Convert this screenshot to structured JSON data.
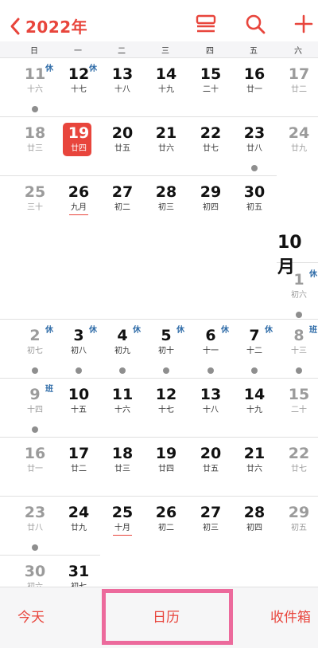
{
  "nav": {
    "back_label": "2022年",
    "icons": [
      "list-view-icon",
      "search-icon",
      "add-icon"
    ]
  },
  "weekdays": [
    "日",
    "一",
    "二",
    "三",
    "四",
    "五",
    "六"
  ],
  "month_label": "10月",
  "days": [
    {
      "n": "11",
      "l": "十六",
      "badge": "休",
      "dot": true,
      "muted": true
    },
    {
      "n": "12",
      "l": "十七",
      "badge": "休"
    },
    {
      "n": "13",
      "l": "十八"
    },
    {
      "n": "14",
      "l": "十九"
    },
    {
      "n": "15",
      "l": "二十"
    },
    {
      "n": "16",
      "l": "廿一"
    },
    {
      "n": "17",
      "l": "廿二",
      "muted": true
    },
    {
      "n": "18",
      "l": "廿三",
      "muted": true
    },
    {
      "n": "19",
      "l": "廿四",
      "today": true
    },
    {
      "n": "20",
      "l": "廿五"
    },
    {
      "n": "21",
      "l": "廿六"
    },
    {
      "n": "22",
      "l": "廿七"
    },
    {
      "n": "23",
      "l": "廿八",
      "dot": true
    },
    {
      "n": "24",
      "l": "廿九",
      "muted": true
    },
    {
      "n": "25",
      "l": "三十",
      "muted": true
    },
    {
      "n": "26",
      "l": "九月",
      "underline": true
    },
    {
      "n": "27",
      "l": "初二"
    },
    {
      "n": "28",
      "l": "初三"
    },
    {
      "n": "29",
      "l": "初四"
    },
    {
      "n": "30",
      "l": "初五"
    },
    {
      "n": "1",
      "l": "初六",
      "badge": "休",
      "dot": true,
      "muted": true
    },
    {
      "n": "2",
      "l": "初七",
      "badge": "休",
      "dot": true,
      "muted": true
    },
    {
      "n": "3",
      "l": "初八",
      "badge": "休",
      "dot": true
    },
    {
      "n": "4",
      "l": "初九",
      "badge": "休",
      "dot": true
    },
    {
      "n": "5",
      "l": "初十",
      "badge": "休",
      "dot": true
    },
    {
      "n": "6",
      "l": "十一",
      "badge": "休",
      "dot": true
    },
    {
      "n": "7",
      "l": "十二",
      "badge": "休",
      "dot": true
    },
    {
      "n": "8",
      "l": "十三",
      "badge": "班",
      "dot": true,
      "muted": true
    },
    {
      "n": "9",
      "l": "十四",
      "badge": "班",
      "dot": true,
      "muted": true
    },
    {
      "n": "10",
      "l": "十五"
    },
    {
      "n": "11",
      "l": "十六"
    },
    {
      "n": "12",
      "l": "十七"
    },
    {
      "n": "13",
      "l": "十八"
    },
    {
      "n": "14",
      "l": "十九"
    },
    {
      "n": "15",
      "l": "二十",
      "muted": true
    },
    {
      "n": "16",
      "l": "廿一",
      "muted": true
    },
    {
      "n": "17",
      "l": "廿二"
    },
    {
      "n": "18",
      "l": "廿三"
    },
    {
      "n": "19",
      "l": "廿四"
    },
    {
      "n": "20",
      "l": "廿五"
    },
    {
      "n": "21",
      "l": "廿六"
    },
    {
      "n": "22",
      "l": "廿七",
      "muted": true
    },
    {
      "n": "23",
      "l": "廿八",
      "dot": true,
      "muted": true
    },
    {
      "n": "24",
      "l": "廿九"
    },
    {
      "n": "25",
      "l": "十月",
      "underline": true
    },
    {
      "n": "26",
      "l": "初二"
    },
    {
      "n": "27",
      "l": "初三"
    },
    {
      "n": "28",
      "l": "初四"
    },
    {
      "n": "29",
      "l": "初五",
      "muted": true
    },
    {
      "n": "30",
      "l": "初六",
      "muted": true
    },
    {
      "n": "31",
      "l": "初七"
    }
  ],
  "tabbar": {
    "today": "今天",
    "calendars": "日历",
    "inbox": "收件箱"
  },
  "colors": {
    "accent": "#e8453c",
    "badge": "#2f6ca8",
    "highlight": "#ec6a9c"
  }
}
